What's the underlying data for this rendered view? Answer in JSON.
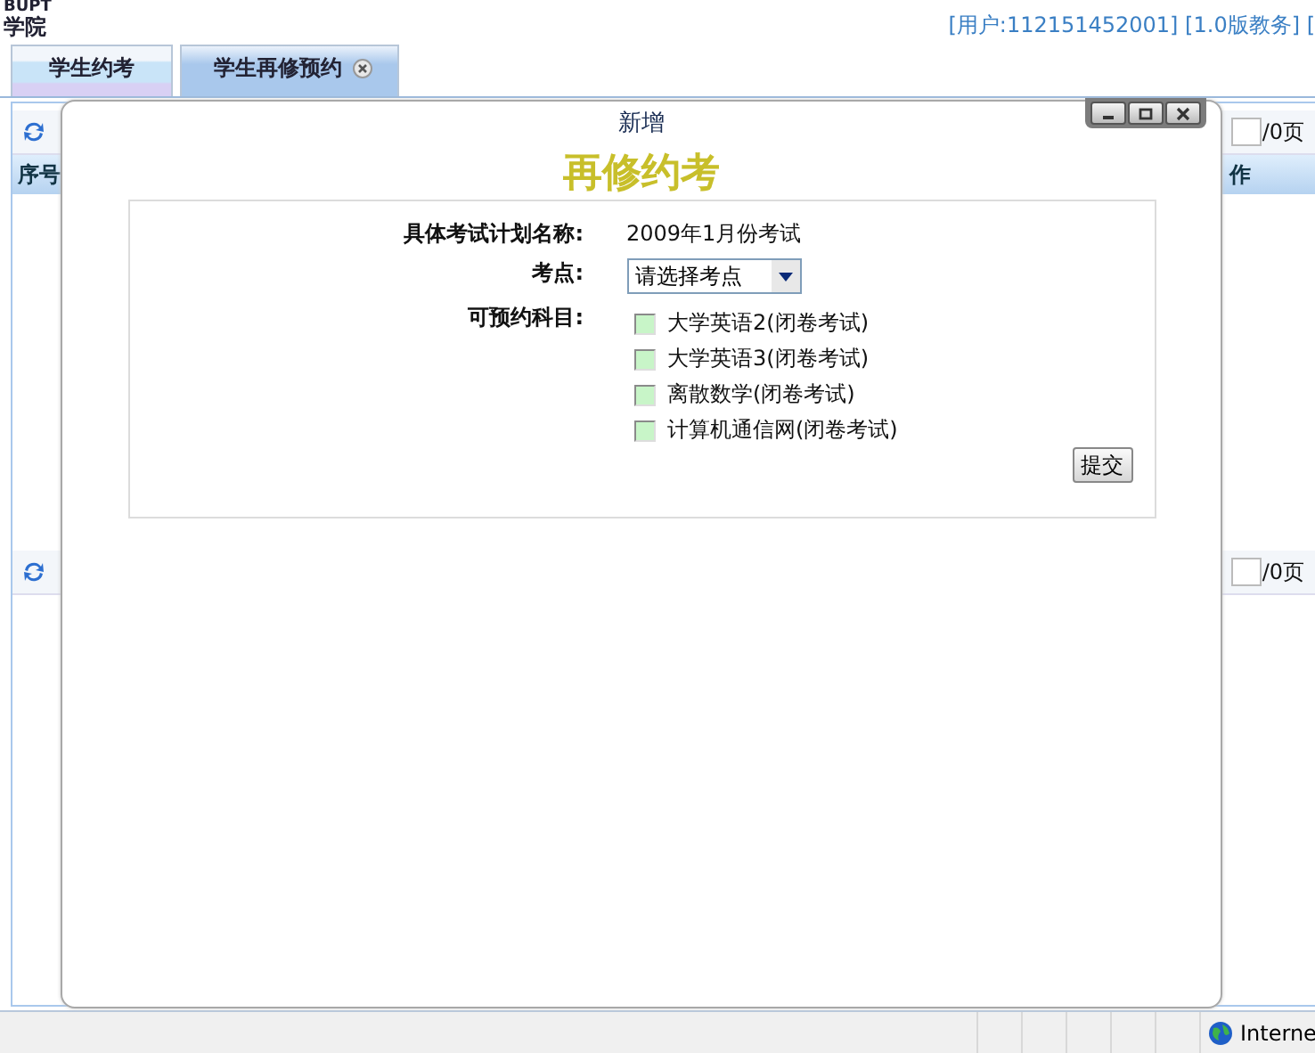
{
  "header": {
    "logo_text": "BUPT",
    "school": "学院",
    "user_info": "[用户:112151452001] [1.0版教务] ["
  },
  "tabs": [
    {
      "label": "学生约考",
      "selected": false,
      "closable": false
    },
    {
      "label": "学生再修预约",
      "selected": true,
      "closable": true
    }
  ],
  "grid": {
    "columns": [
      "序号",
      "作"
    ],
    "pager_suffix": "/0页",
    "bottom_pager_suffix": "/0页"
  },
  "dialog": {
    "title": "新增",
    "heading": "再修约考",
    "plan_label": "具体考试计划名称:",
    "plan_value": "2009年1月份考试",
    "site_label": "考点:",
    "site_value": "请选择考点",
    "subjects_label": "可预约科目:",
    "subjects": [
      {
        "label": "大学英语2(闭卷考试)",
        "checked": false
      },
      {
        "label": "大学英语3(闭卷考试)",
        "checked": false
      },
      {
        "label": "离散数学(闭卷考试)",
        "checked": false
      },
      {
        "label": "计算机通信网(闭卷考试)",
        "checked": false
      }
    ],
    "submit": "提交"
  },
  "status_bar": {
    "zone": "Interne"
  }
}
